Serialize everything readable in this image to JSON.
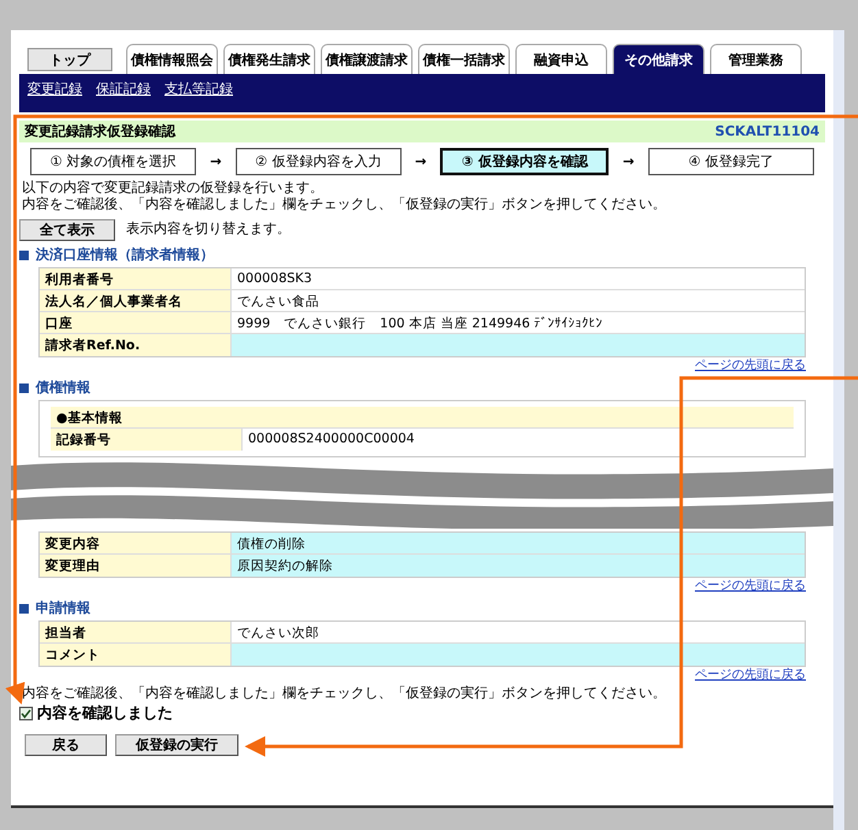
{
  "home_button": "トップ",
  "tabs": [
    {
      "label": "債権情報照会",
      "selected": false
    },
    {
      "label": "債権発生請求",
      "selected": false
    },
    {
      "label": "債権譲渡請求",
      "selected": false
    },
    {
      "label": "債権一括請求",
      "selected": false
    },
    {
      "label": "融資申込",
      "selected": false
    },
    {
      "label": "その他請求",
      "selected": true
    },
    {
      "label": "管理業務",
      "selected": false
    }
  ],
  "sub_links": [
    "変更記録",
    "保証記録",
    "支払等記録"
  ],
  "title": "変更記録請求仮登録確認",
  "screen_id": "SCKALT11104",
  "step_separator": "→",
  "steps": [
    {
      "label": "① 対象の債権を選択",
      "selected": false
    },
    {
      "label": "② 仮登録内容を入力",
      "selected": false
    },
    {
      "label": "③ 仮登録内容を確認",
      "selected": true
    },
    {
      "label": "④ 仮登録完了",
      "selected": false
    }
  ],
  "instructions": [
    "以下の内容で変更記録請求の仮登録を行います。",
    "内容をご確認後、「内容を確認しました」欄をチェックし、「仮登録の実行」ボタンを押してください。"
  ],
  "show_all_button": "全て表示",
  "show_all_note": "表示内容を切り替えます。",
  "blocks": [
    {
      "kind": "section",
      "heading": "決済口座情報（請求者情報）",
      "rows": [
        {
          "label": "利用者番号",
          "value": "000008SK3",
          "highlighted": false
        },
        {
          "label": "法人名／個人事業者名",
          "value": "でんさい食品",
          "highlighted": false
        },
        {
          "label": "口座",
          "value": "9999　でんさい銀行　100 本店 当座 2149946 ﾃﾞﾝｻｲｼｮｸﾋﾝ",
          "highlighted": false
        },
        {
          "label": "請求者Ref.No.",
          "highlighted": true
        }
      ],
      "back_link": "ページの先頭に戻る"
    },
    {
      "kind": "section",
      "heading": "債権情報",
      "subheading": "●基本情報",
      "rows": [
        {
          "label": "記録番号",
          "value": "000008S2400000C00004",
          "highlighted": false
        }
      ]
    },
    {
      "kind": "break"
    },
    {
      "kind": "rows",
      "rows": [
        {
          "label": "変更内容",
          "value": "債権の削除",
          "highlighted": true
        },
        {
          "label": "変更理由",
          "value": "原因契約の解除",
          "highlighted": true
        }
      ],
      "back_link": "ページの先頭に戻る"
    },
    {
      "kind": "section",
      "heading": "申請情報",
      "rows": [
        {
          "label": "担当者",
          "value": "でんさい次郎",
          "highlighted": false
        },
        {
          "label": "コメント",
          "highlighted": true
        }
      ],
      "back_link": "ページの先頭に戻る"
    }
  ],
  "confirm_note": "内容をご確認後、「内容を確認しました」欄をチェックし、「仮登録の実行」ボタンを押してください。",
  "confirm_checkbox": {
    "label": "内容を確認しました",
    "checked": true
  },
  "buttons": [
    "戻る",
    "仮登録の実行"
  ]
}
